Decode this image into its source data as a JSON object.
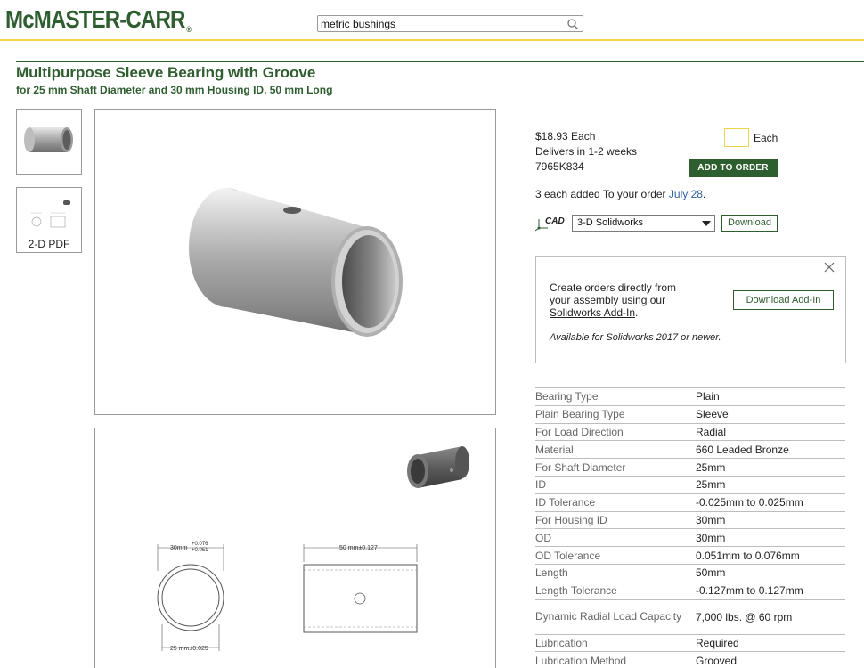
{
  "header": {
    "logo": "McMASTER-CARR",
    "logo_mark": "®",
    "search_value": "metric bushings"
  },
  "product": {
    "title": "Multipurpose Sleeve Bearing with Groove",
    "subtitle": "for 25 mm Shaft Diameter and 30 mm Housing ID, 50 mm Long"
  },
  "thumbnails": [
    {
      "label": ""
    },
    {
      "label": "2-D PDF"
    }
  ],
  "drawing": {
    "dim_od": "30mm",
    "tol_od_plus": "+0.076",
    "tol_od_minus": "+0.051",
    "dim_length": "50 mm±0.127",
    "dim_id": "25 mm±0.025"
  },
  "order": {
    "price": "$18.93 Each",
    "delivery": "Delivers in 1-2 weeks",
    "part_number": "7965K834",
    "qty_unit": "Each",
    "add_button": "ADD TO ORDER",
    "added_prefix": "3 each added To your order ",
    "added_date": "July 28",
    "added_suffix": "."
  },
  "cad": {
    "icon_label": "CAD",
    "selected": "3-D Solidworks",
    "download_button": "Download"
  },
  "addin": {
    "line1": "Create orders directly from",
    "line2": "your assembly using our",
    "link": "Solidworks Add-In",
    "link_suffix": ".",
    "note": "Available for Solidworks 2017 or newer.",
    "button": "Download Add-In"
  },
  "specs": [
    {
      "k": "Bearing Type",
      "v": "Plain"
    },
    {
      "k": "Plain Bearing Type",
      "v": "Sleeve"
    },
    {
      "k": "For Load Direction",
      "v": "Radial"
    },
    {
      "k": "Material",
      "v": "660 Leaded Bronze"
    },
    {
      "k": "For Shaft Diameter",
      "v": "25mm"
    },
    {
      "k": "ID",
      "v": "25mm"
    },
    {
      "k": "ID Tolerance",
      "v": "-0.025mm to 0.025mm"
    },
    {
      "k": "For Housing ID",
      "v": "30mm"
    },
    {
      "k": "OD",
      "v": "30mm"
    },
    {
      "k": "OD Tolerance",
      "v": "0.051mm to 0.076mm"
    },
    {
      "k": "Length",
      "v": "50mm"
    },
    {
      "k": "Length Tolerance",
      "v": "-0.127mm to 0.127mm"
    },
    {
      "k": "Dynamic Radial Load Capacity",
      "v": "7,000 lbs. @ 60 rpm"
    },
    {
      "k": "Lubrication",
      "v": "Required"
    },
    {
      "k": "Lubrication Method",
      "v": "Grooved"
    }
  ],
  "colors": {
    "brand_green": "#2d5f2e",
    "accent_yellow": "#f3d444",
    "link_blue": "#2a5ea8"
  }
}
